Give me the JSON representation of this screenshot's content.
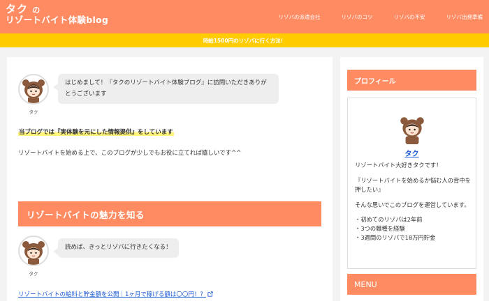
{
  "header": {
    "logo_line1_main": "タク",
    "logo_line1_small": "の",
    "logo_line2": "リゾートバイト体験blog",
    "nav": [
      {
        "label": "リゾバの派遣会社"
      },
      {
        "label": "リゾバのコツ"
      },
      {
        "label": "リゾバの不安"
      },
      {
        "label": "リゾバ出発準備"
      }
    ],
    "brand_color": "#ff8b62"
  },
  "notice": {
    "text": "時給1500円のリゾバに行く方法！",
    "color": "#ffcc00"
  },
  "main": {
    "intro_bubble": {
      "avatar_name": "タク",
      "text": "はじめまして！『タクのリゾートバイト体験ブログ』に訪問いただきありがとうございます"
    },
    "highlight": "当ブログでは『実体験を元にした情報提供』をしています",
    "lead": "リゾートバイトを始める上で、このブログが少しでもお役に立てれば嬉しいです^^",
    "section_heading": "リゾートバイトの魅力を知る",
    "section_bubble": {
      "avatar_name": "タク",
      "text": "読めば、きっとリゾバに行きたくなる！"
    },
    "article_link": "リゾートバイトの給料と貯金額を公開｜1ヶ月で稼げる額は〇〇円！？"
  },
  "sidebar": {
    "profile_heading": "プロフィール",
    "profile_name": "タク",
    "profile_desc": "リゾートバイト大好きタクです！",
    "profile_quote": "『リゾートバイトを始めるか悩む人の背中を押したい』",
    "profile_mission": "そんな思いでこのブログを運営しています。",
    "profile_facts": [
      "初めてのリゾバは2年前",
      "3つの職種を経験",
      "3週間のリゾバで18万円貯金"
    ],
    "menu_heading": "MENU"
  }
}
